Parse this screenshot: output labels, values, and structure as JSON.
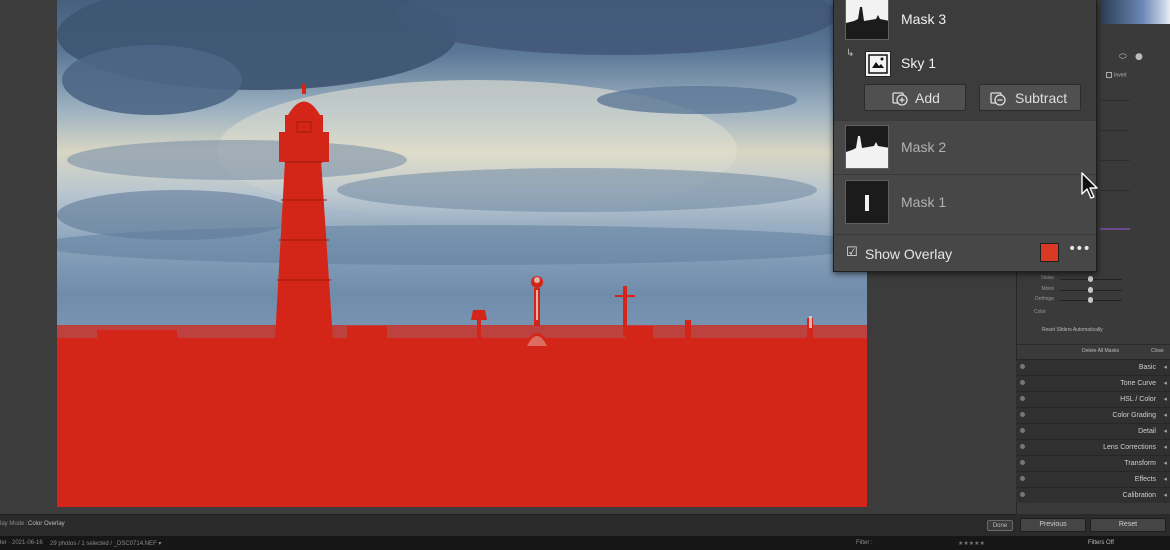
{
  "masks_panel": {
    "mask3": {
      "label": "Mask 3"
    },
    "sky1": {
      "label": "Sky 1"
    },
    "add_label": "Add",
    "subtract_label": "Subtract",
    "mask2": {
      "label": "Mask 2"
    },
    "mask1": {
      "label": "Mask 1"
    },
    "show_overlay_label": "Show Overlay",
    "show_overlay_checked": true,
    "overlay_color": "#d83a23",
    "more_icon": "ellipsis-icon"
  },
  "right_panel": {
    "invert_label": "Invert",
    "sliders": [
      {
        "label": "Noise",
        "value": 0
      },
      {
        "label": "Moiré",
        "value": 0
      },
      {
        "label": "Defringe",
        "value": 0
      }
    ],
    "color_label": "Color",
    "reset_sliders_label": "Reset Sliders Automatically",
    "delete_all_label": "Delete All Masks",
    "close_label": "Close",
    "sections": [
      "Basic",
      "Tone Curve",
      "HSL / Color",
      "Color Grading",
      "Detail",
      "Lens Corrections",
      "Transform",
      "Effects",
      "Calibration"
    ],
    "previous_label": "Previous",
    "reset_label": "Reset"
  },
  "toolbar": {
    "overlay_mode_label": "lay Mode :",
    "overlay_mode_value": "Color Overlay",
    "done_label": "Done"
  },
  "filmstrip": {
    "date_text": "ler · 2021-06-16",
    "photos_text": "29 photos / 1 selected / _DSC0714.NEF ▾",
    "filter_label": "Filter :",
    "filters_off_label": "Filters Off"
  },
  "colors": {
    "mask_overlay": "#d83a23",
    "panel_bg": "#474747",
    "app_bg": "#3b3b3b"
  }
}
